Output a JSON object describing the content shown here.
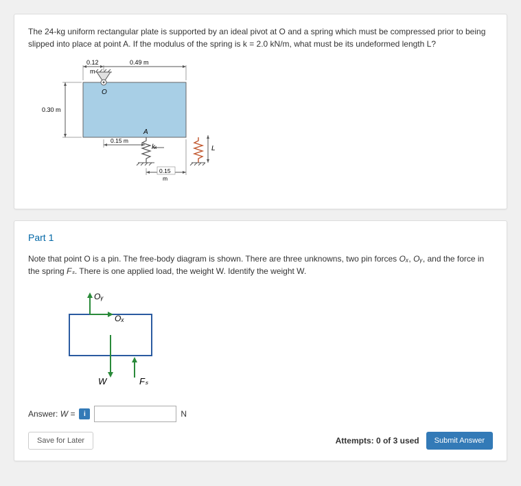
{
  "problem": {
    "text": "The 24-kg uniform rectangular plate is supported by an ideal pivot at O and a spring which must be compressed prior to being slipped into place at point A. If the modulus of the spring is k = 2.0 kN/m, what must be its undeformed length L?",
    "dims": {
      "d012": "0.12",
      "m1": "m",
      "d049": "0.49 m",
      "d030": "0.30 m",
      "d015m": "0.15 m",
      "d015": "0.15",
      "m2": "m",
      "O": "O",
      "A": "A",
      "k": "k",
      "L": "L"
    }
  },
  "part1": {
    "title": "Part 1",
    "note_before_italics": "Note that point O is a pin. The free-body diagram is shown. There are three unknowns, two pin forces ",
    "ox": "Oₓ",
    "comma": ", ",
    "oy": "Oᵧ",
    "note_mid": ", and the force in the spring ",
    "fs": "Fₛ",
    "note_after": ". There is one applied load, the weight W. Identify the weight W.",
    "fbd": {
      "Oy": "Oᵧ",
      "Ox": "Oₓ",
      "W": "W",
      "Fs": "Fₛ"
    },
    "answer_label_pre": "Answer: ",
    "answer_label_w": "W = ",
    "hint": "i",
    "unit": "N",
    "save": "Save for Later",
    "attempts": "Attempts: 0 of 3 used",
    "submit": "Submit Answer"
  }
}
